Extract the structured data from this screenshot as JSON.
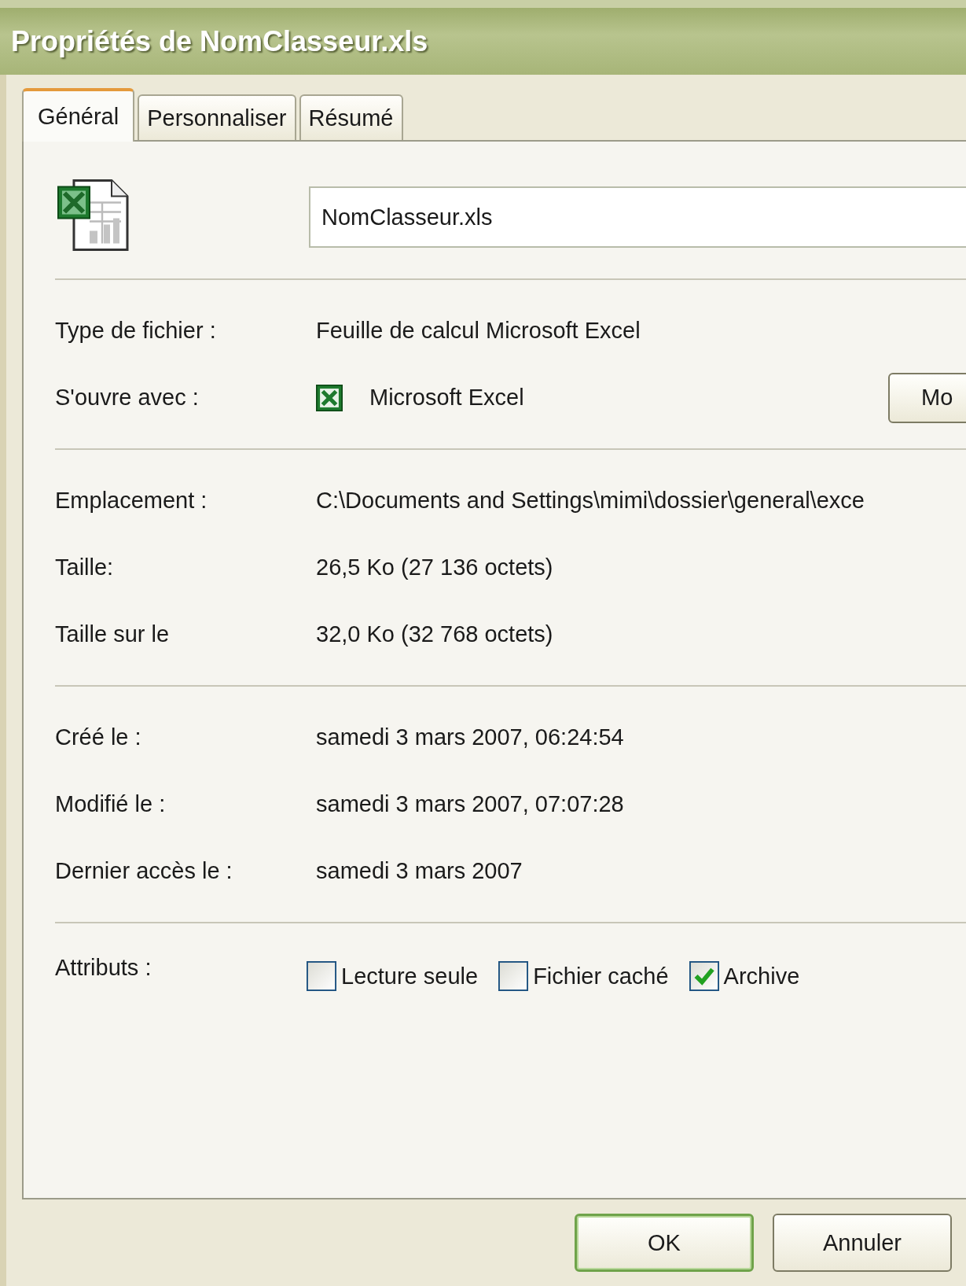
{
  "window": {
    "title": "Propriétés de NomClasseur.xls"
  },
  "tabs": [
    {
      "label": "Général",
      "selected": true
    },
    {
      "label": "Personnaliser",
      "selected": false
    },
    {
      "label": "Résumé",
      "selected": false
    }
  ],
  "file_name": {
    "value": "NomClasseur.xls"
  },
  "sections": [
    {
      "rows": [
        {
          "label": "Type de fichier :",
          "value": "Feuille de calcul Microsoft Excel"
        },
        {
          "label": "S'ouvre avec :",
          "value": "Microsoft Excel",
          "kind": "app",
          "button": "Mo"
        }
      ]
    },
    {
      "rows": [
        {
          "label": "Emplacement :",
          "value": "C:\\Documents and Settings\\mimi\\dossier\\general\\exce"
        },
        {
          "label": "Taille:",
          "value": "26,5 Ko (27 136 octets)"
        },
        {
          "label": "Taille sur le",
          "value": "32,0 Ko (32 768 octets)"
        }
      ]
    },
    {
      "rows": [
        {
          "label": "Créé le :",
          "value": "samedi 3 mars 2007, 06:24:54"
        },
        {
          "label": "Modifié le :",
          "value": "samedi 3 mars 2007, 07:07:28"
        },
        {
          "label": "Dernier accès le :",
          "value": "samedi 3 mars 2007"
        }
      ]
    }
  ],
  "attributes": {
    "label": "Attributs :",
    "options": [
      {
        "label": "Lecture seule",
        "checked": false
      },
      {
        "label": "Fichier caché",
        "checked": false
      },
      {
        "label": "Archive",
        "checked": true
      }
    ]
  },
  "buttons": [
    {
      "label": "OK",
      "default": true
    },
    {
      "label": "Annuler",
      "default": false
    }
  ]
}
